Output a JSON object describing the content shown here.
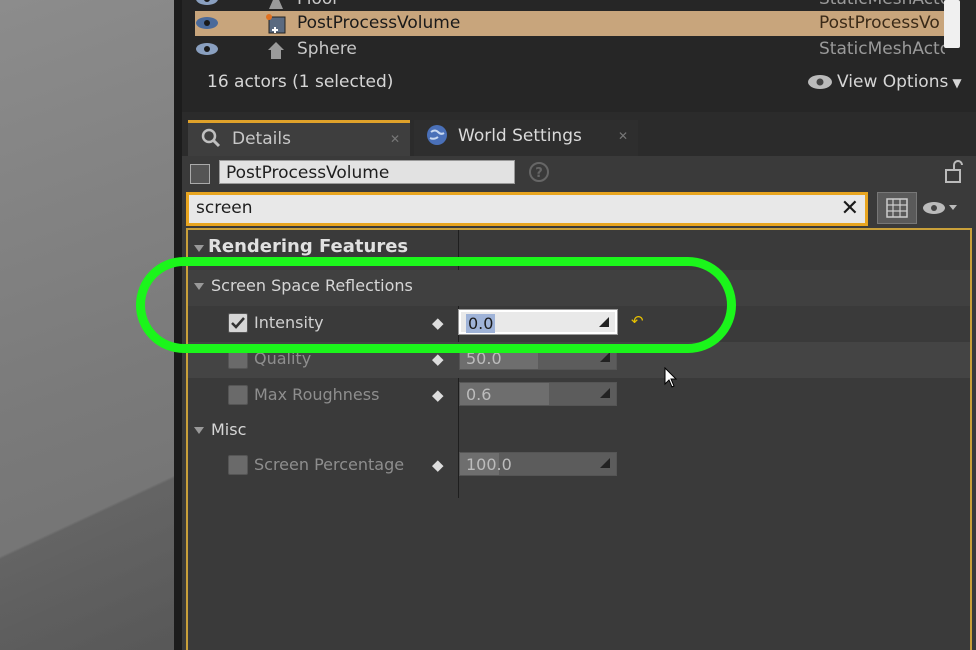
{
  "outliner": {
    "rows": [
      {
        "label": "Floor",
        "type": "StaticMeshActo",
        "selected": false
      },
      {
        "label": "PostProcessVolume",
        "type": "PostProcessVo",
        "selected": true
      },
      {
        "label": "Sphere",
        "type": "StaticMeshActo",
        "selected": false
      }
    ],
    "status": "16 actors (1 selected)",
    "view_options": "View Options"
  },
  "tabs": [
    {
      "label": "Details",
      "active": true,
      "icon": "magnifier-icon"
    },
    {
      "label": "World Settings",
      "active": false,
      "icon": "globe-icon"
    }
  ],
  "details": {
    "actor_name": "PostProcessVolume",
    "search_value": "screen",
    "categories": {
      "rendering_features": "Rendering Features",
      "ssr": "Screen Space Reflections",
      "misc": "Misc"
    },
    "properties": {
      "intensity": {
        "label": "Intensity",
        "value": "0.0",
        "enabled": true
      },
      "quality": {
        "label": "Quality",
        "value": "50.0",
        "enabled": false
      },
      "max_roughness": {
        "label": "Max Roughness",
        "value": "0.6",
        "enabled": false
      },
      "screen_percentage": {
        "label": "Screen Percentage",
        "value": "100.0",
        "enabled": false
      }
    }
  },
  "colors": {
    "selection": "#c8a57c",
    "accent_border": "#e8a520",
    "annotation": "#1bf51b"
  }
}
